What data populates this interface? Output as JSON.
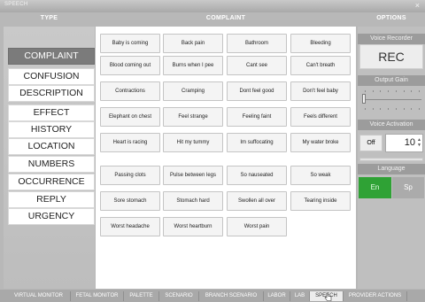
{
  "window": {
    "title": "SPEECH",
    "close_symbol": "×"
  },
  "headers": {
    "type": "TYPE",
    "complaint": "COMPLAINT",
    "options": "OPTIONS"
  },
  "type_list": {
    "selected": "COMPLAINT",
    "items": [
      "COMPLAINT",
      "CONFUSION",
      "DESCRIPTION",
      "EFFECT",
      "HISTORY",
      "LOCATION",
      "NUMBERS",
      "OCCURRENCE",
      "REPLY",
      "URGENCY"
    ]
  },
  "complaints": [
    "Baby is coming",
    "Back pain",
    "Bathroom",
    "Bleeding",
    "Blood coming out",
    "Burns when I pee",
    "Cant see",
    "Can't breath",
    "Contractions",
    "Cramping",
    "Dont feel good",
    "Don't feel baby",
    "Elephant on chest",
    "Feel strange",
    "Feeling faint",
    "Feels different",
    "Heart is racing",
    "Hit my tummy",
    "Im suffocating",
    "My water broke",
    "Passing clots",
    "Pulse between legs",
    "So nauseated",
    "So weak",
    "Sore stomach",
    "Stomach hard",
    "Swollen all over",
    "Tearing inside",
    "Worst headache",
    "Worst heartburn",
    "Worst pain"
  ],
  "options": {
    "voice_recorder": {
      "label": "Voice Recorder",
      "button": "REC"
    },
    "output_gain": {
      "label": "Output Gain",
      "level": 0
    },
    "voice_activation": {
      "label": "Voice Activation",
      "toggle": "Off",
      "value": "10",
      "spin_up": "▲",
      "spin_down": "▼",
      "level": 0
    },
    "language": {
      "label": "Language",
      "options": [
        "En",
        "Sp"
      ],
      "selected": "En"
    }
  },
  "tabs": {
    "items": [
      "VIRTUAL MONITOR",
      "FETAL MONITOR",
      "PALETTE",
      "SCENARIO",
      "BRANCH SCENARIO",
      "LABOR",
      "LAB",
      "SPEECH",
      "PROVIDER ACTIONS"
    ],
    "active": "SPEECH"
  },
  "colors": {
    "selected_type": "#7b7b7b",
    "language_active": "#2fa235",
    "window_bg": "#b8b8b8"
  },
  "icons": {
    "close": "close-icon",
    "cursor": "hand-cursor-icon"
  }
}
